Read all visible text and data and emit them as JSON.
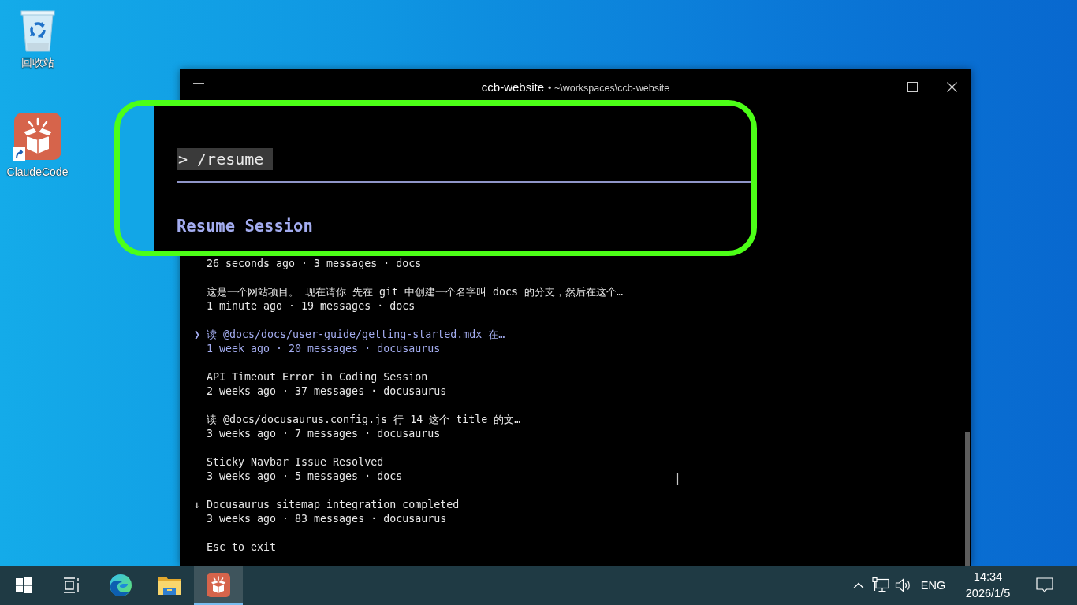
{
  "desktop": {
    "icons": [
      {
        "kind": "recycle-bin",
        "label": "回收站"
      },
      {
        "kind": "app",
        "label": "ClaudeCode"
      }
    ]
  },
  "window": {
    "title": "ccb-website",
    "subtitle": "• ~\\workspaces\\ccb-website"
  },
  "terminal": {
    "sessions": [
      {
        "meta": "26 seconds ago · 3 messages · docs",
        "selected": false
      },
      {
        "title": "这是一个网站项目。 现在请你 先在 git 中创建一个名字叫 docs 的分支，然后在这个…",
        "meta": "1 minute ago · 19 messages · docs",
        "selected": false
      },
      {
        "marker": "❯",
        "title": "读 @docs/docs/user-guide/getting-started.mdx 在…",
        "meta": "1 week ago · 20 messages · docusaurus",
        "selected": true
      },
      {
        "title": "API Timeout Error in Coding Session",
        "meta": "2 weeks ago · 37 messages · docusaurus",
        "selected": false
      },
      {
        "title": "读 @docs/docusaurus.config.js 行 14 这个 title 的文…",
        "meta": "3 weeks ago · 7 messages · docusaurus",
        "selected": false
      },
      {
        "title": "Sticky Navbar Issue Resolved",
        "meta": "3 weeks ago · 5 messages · docs",
        "selected": false
      },
      {
        "marker": "↓",
        "title": "Docusaurus sitemap integration completed",
        "meta": "3 weeks ago · 83 messages · docusaurus",
        "selected": false
      }
    ],
    "footer": "Esc to exit"
  },
  "callout": {
    "prompt": "> /resume",
    "heading": "Resume Session"
  },
  "taskbar": {
    "apps": [
      {
        "kind": "start",
        "active": false
      },
      {
        "kind": "task-view",
        "active": false
      },
      {
        "kind": "browser",
        "active": false
      },
      {
        "kind": "files",
        "active": false
      },
      {
        "kind": "app",
        "active": true
      }
    ],
    "tray": {
      "language": "ENG",
      "time": "14:34",
      "date": "2026/1/5"
    }
  }
}
